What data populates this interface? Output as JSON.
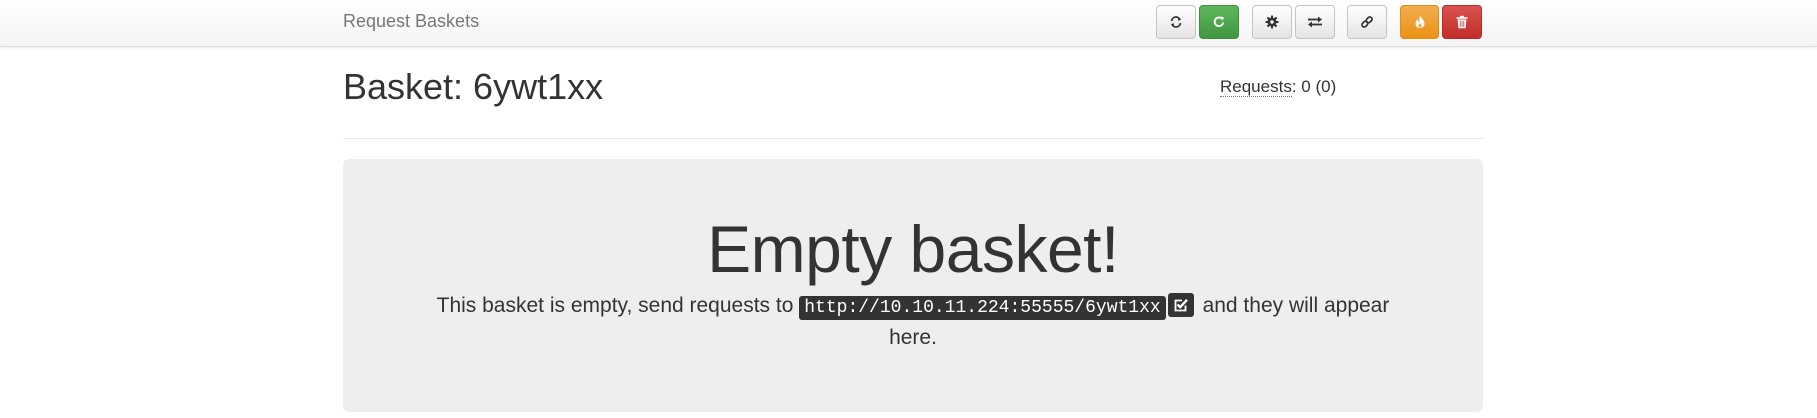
{
  "navbar": {
    "brand": "Request Baskets",
    "buttons": [
      {
        "name": "refresh-button",
        "icon": "refresh-icon"
      },
      {
        "name": "auto-refresh-button",
        "icon": "refresh-icon"
      },
      {
        "name": "settings-button",
        "icon": "gear-icon"
      },
      {
        "name": "responses-button",
        "icon": "exchange-icon"
      },
      {
        "name": "share-link-button",
        "icon": "link-icon"
      },
      {
        "name": "destroy-requests-button",
        "icon": "fire-icon"
      },
      {
        "name": "delete-basket-button",
        "icon": "trash-icon"
      }
    ]
  },
  "header": {
    "title": "Basket: 6ywt1xx",
    "requests_label": "Requests",
    "requests_value": ": 0 (0)"
  },
  "empty": {
    "heading": "Empty basket!",
    "text_before": "This basket is empty, send requests to",
    "url": "http://10.10.11.224:55555/6ywt1xx",
    "text_after": "and they will appear here."
  },
  "colors": {
    "green": "#5cb85c",
    "orange": "#f0ad4e",
    "red": "#d9534f",
    "jumbotron": "#eeeeee"
  }
}
